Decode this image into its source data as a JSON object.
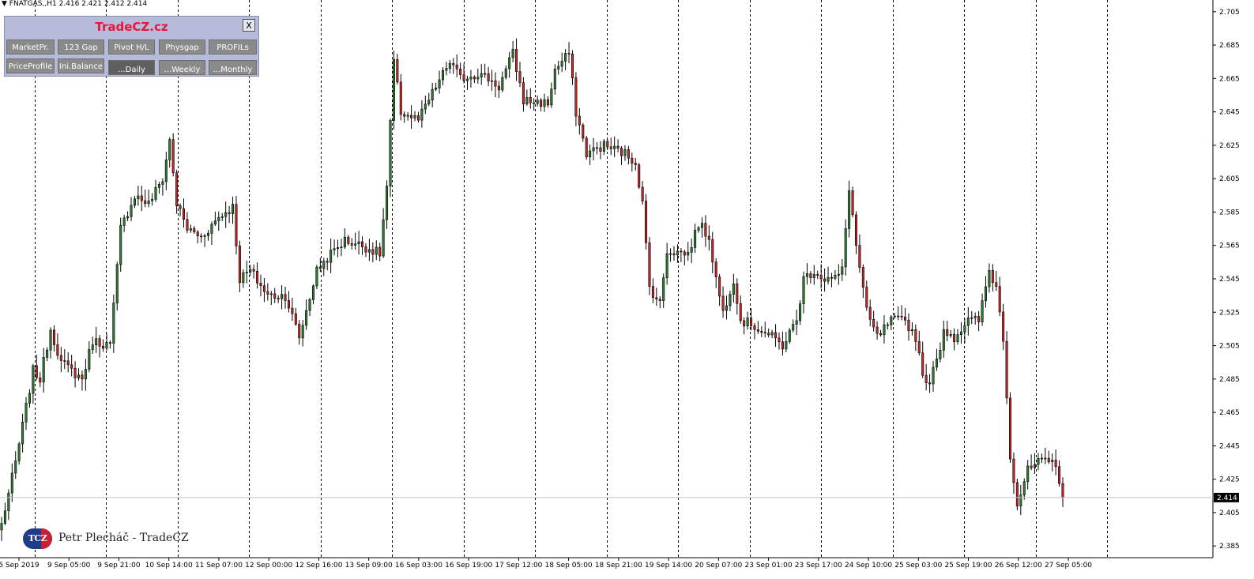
{
  "window": {
    "ticker": "FNATGAS,,H1  2.416 2.421 2.412 2.414"
  },
  "panel": {
    "title": "TradeCZ.cz",
    "close_label": "X",
    "row1": [
      "MarketPr.",
      "123 Gap",
      "Pivot H/L",
      "Physgap",
      "PROFILs"
    ],
    "row2": [
      "PriceProfile",
      "Ini.Balance",
      "...Daily",
      "...Weekly",
      "...Monthly"
    ]
  },
  "branding": {
    "logo_text": "TCZ",
    "author": "Petr Plecháč - TradeCZ"
  },
  "colors": {
    "bull": "#2e7d32",
    "bear": "#c62828",
    "panel_bg": "#b5bbd8",
    "button_bg": "#8a8a8a",
    "title": "#e8153c"
  },
  "chart_data": {
    "type": "candlestick",
    "ylim": [
      2.378,
      2.712
    ],
    "y_ticks": [
      "2.705",
      "2.685",
      "2.665",
      "2.645",
      "2.625",
      "2.605",
      "2.585",
      "2.565",
      "2.545",
      "2.525",
      "2.505",
      "2.485",
      "2.465",
      "2.445",
      "2.425",
      "2.405",
      "2.385"
    ],
    "current_price": "2.414",
    "x_labels": [
      "5 Sep 2019",
      "9 Sep 05:00",
      "9 Sep 21:00",
      "10 Sep 14:00",
      "11 Sep 07:00",
      "12 Sep 00:00",
      "12 Sep 16:00",
      "13 Sep 09:00",
      "16 Sep 03:00",
      "16 Sep 19:00",
      "17 Sep 12:00",
      "18 Sep 05:00",
      "18 Sep 21:00",
      "19 Sep 14:00",
      "20 Sep 07:00",
      "23 Sep 01:00",
      "23 Sep 17:00",
      "24 Sep 10:00",
      "25 Sep 03:00",
      "25 Sep 19:00",
      "26 Sep 12:00",
      "27 Sep 05:00"
    ],
    "day_separators": 16,
    "grid": false,
    "waypoints": [
      [
        0,
        2.398
      ],
      [
        4,
        2.435
      ],
      [
        9,
        2.49
      ],
      [
        11,
        2.485
      ],
      [
        14,
        2.515
      ],
      [
        17,
        2.495
      ],
      [
        23,
        2.485
      ],
      [
        26,
        2.508
      ],
      [
        31,
        2.505
      ],
      [
        34,
        2.575
      ],
      [
        38,
        2.595
      ],
      [
        42,
        2.59
      ],
      [
        46,
        2.605
      ],
      [
        48,
        2.628
      ],
      [
        50,
        2.59
      ],
      [
        53,
        2.575
      ],
      [
        57,
        2.57
      ],
      [
        62,
        2.582
      ],
      [
        66,
        2.588
      ],
      [
        68,
        2.545
      ],
      [
        71,
        2.55
      ],
      [
        76,
        2.535
      ],
      [
        81,
        2.535
      ],
      [
        85,
        2.51
      ],
      [
        90,
        2.55
      ],
      [
        94,
        2.56
      ],
      [
        98,
        2.568
      ],
      [
        103,
        2.565
      ],
      [
        108,
        2.56
      ],
      [
        110,
        2.6
      ],
      [
        112,
        2.675
      ],
      [
        114,
        2.645
      ],
      [
        119,
        2.64
      ],
      [
        124,
        2.66
      ],
      [
        128,
        2.675
      ],
      [
        131,
        2.665
      ],
      [
        136,
        2.668
      ],
      [
        139,
        2.665
      ],
      [
        142,
        2.66
      ],
      [
        146,
        2.68
      ],
      [
        149,
        2.652
      ],
      [
        156,
        2.65
      ],
      [
        158,
        2.67
      ],
      [
        162,
        2.68
      ],
      [
        164,
        2.645
      ],
      [
        167,
        2.62
      ],
      [
        172,
        2.625
      ],
      [
        178,
        2.62
      ],
      [
        181,
        2.615
      ],
      [
        183,
        2.59
      ],
      [
        185,
        2.54
      ],
      [
        188,
        2.53
      ],
      [
        190,
        2.562
      ],
      [
        196,
        2.56
      ],
      [
        199,
        2.578
      ],
      [
        202,
        2.57
      ],
      [
        204,
        2.545
      ],
      [
        206,
        2.525
      ],
      [
        209,
        2.545
      ],
      [
        211,
        2.52
      ],
      [
        214,
        2.518
      ],
      [
        220,
        2.51
      ],
      [
        223,
        2.505
      ],
      [
        227,
        2.52
      ],
      [
        229,
        2.545
      ],
      [
        232,
        2.55
      ],
      [
        235,
        2.545
      ],
      [
        238,
        2.545
      ],
      [
        240,
        2.55
      ],
      [
        242,
        2.6
      ],
      [
        244,
        2.565
      ],
      [
        247,
        2.525
      ],
      [
        250,
        2.51
      ],
      [
        254,
        2.52
      ],
      [
        258,
        2.52
      ],
      [
        261,
        2.51
      ],
      [
        264,
        2.48
      ],
      [
        267,
        2.495
      ],
      [
        269,
        2.515
      ],
      [
        272,
        2.51
      ],
      [
        276,
        2.52
      ],
      [
        279,
        2.52
      ],
      [
        282,
        2.55
      ],
      [
        284,
        2.54
      ],
      [
        286,
        2.51
      ],
      [
        288,
        2.44
      ],
      [
        290,
        2.41
      ],
      [
        293,
        2.43
      ],
      [
        296,
        2.435
      ],
      [
        301,
        2.435
      ],
      [
        303,
        2.414
      ]
    ]
  }
}
